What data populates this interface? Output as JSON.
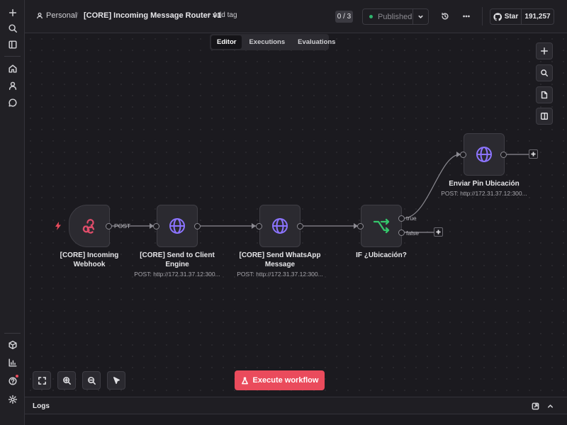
{
  "header": {
    "workspace": "Personal",
    "separator": "/",
    "workflow_name": "[CORE] Incoming Message Router v1",
    "add_tag": "+ Add tag",
    "counter": "0 / 3",
    "status": "Published",
    "github_star": "Star",
    "github_count": "191,257"
  },
  "tabs": [
    {
      "label": "Editor",
      "active": true
    },
    {
      "label": "Executions",
      "active": false
    },
    {
      "label": "Evaluations",
      "active": false
    }
  ],
  "nodes": {
    "webhook": {
      "title": "[CORE] Incoming Webhook",
      "icon": "webhook-icon",
      "color": "#e04d6a"
    },
    "send_client": {
      "title": "[CORE] Send to Client Engine",
      "subtitle": "POST: http://172.31.37.12:300...",
      "icon": "globe-icon",
      "color": "#8c74ff"
    },
    "send_whatsapp": {
      "title": "[CORE] Send WhatsApp Message",
      "subtitle": "POST: http://172.31.37.12:300...",
      "icon": "globe-icon",
      "color": "#8c74ff"
    },
    "if_ubicacion": {
      "title": "IF ¿Ubicación?",
      "icon": "branch-icon",
      "color": "#35c66b"
    },
    "enviar_pin": {
      "title": "Enviar Pin Ubicación",
      "subtitle": "POST: http://172.31.37.12:300...",
      "icon": "globe-icon",
      "color": "#8c74ff"
    }
  },
  "edges": {
    "post_label": "POST",
    "true_label": "true",
    "false_label": "false"
  },
  "execute_button": "Execute workflow",
  "logs": {
    "title": "Logs"
  },
  "colors": {
    "accent": "#ea4b5c",
    "published_dot": "#2fb36c"
  }
}
